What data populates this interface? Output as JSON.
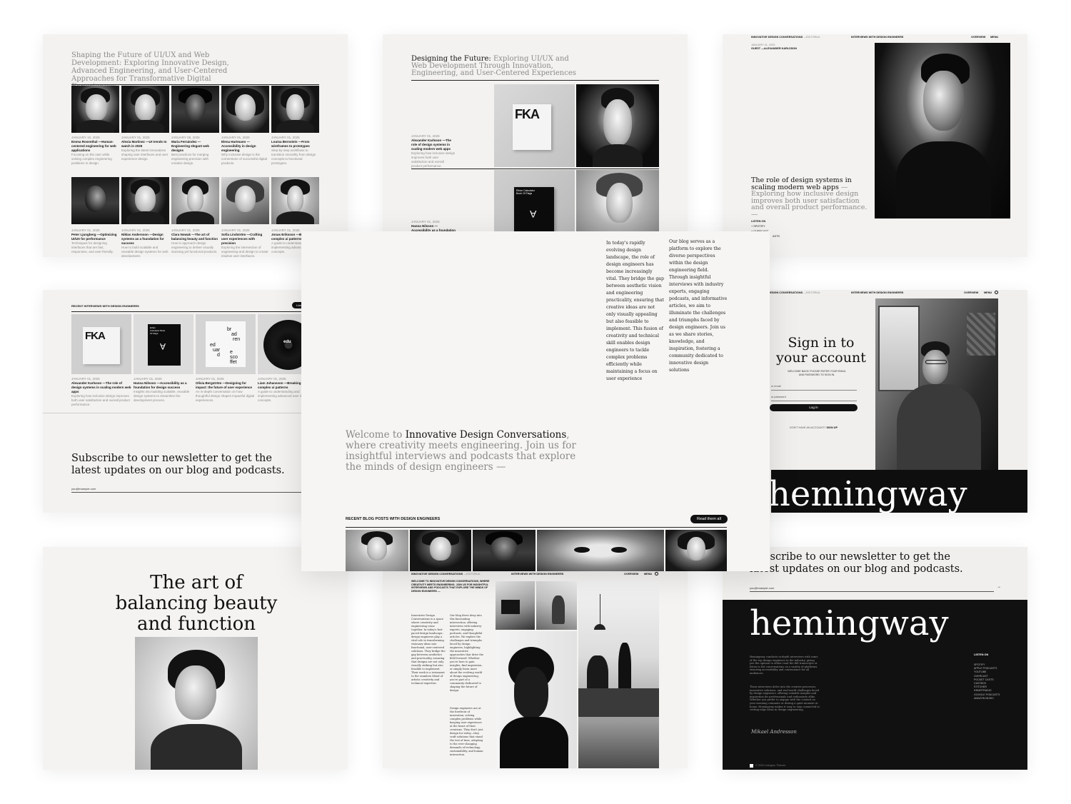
{
  "p1": {
    "headline": "Shaping the Future of UI/UX and Web Development: Exploring Innovative Design, Advanced Engineering, and User-Centered Approaches for Transformative Digital Experiences.",
    "row1": [
      {
        "date": "JANUARY 10, 2025",
        "title": "Emma Rosenthal —Human-centered engineering for web applications",
        "desc": "Focusing on the user while solving complex engineering problems in design."
      },
      {
        "date": "JANUARY 01, 2025",
        "title": "Alexia Martinez —UI trends to watch in 2025",
        "desc": "Exploring the latest innovations shaping user interfaces and user experience design."
      },
      {
        "date": "JANUARY 05, 2025",
        "title": "Maria Fernández —Engineering elegant web designs",
        "desc": "Best practices for merging engineering precision with creative design."
      },
      {
        "date": "JANUARY 01, 2025",
        "title": "Elena Hartmann —Accessibility in design engineering",
        "desc": "Why inclusive design is the cornerstone of successful digital products."
      },
      {
        "date": "JANUARY 01, 2025",
        "title": "Louisa Bernstein —From wireframes to prototypes",
        "desc": "Step-by-step workflows to transition smoothly from design concepts to functional prototypes."
      }
    ],
    "row2": [
      {
        "date": "JANUARY 01, 2025",
        "title": "Peter Ljungberg —Optimizing UI/UX for performance",
        "desc": "Techniques for designing interfaces that are fast, responsive, and user-friendly."
      },
      {
        "date": "JANUARY 01, 2025",
        "title": "Niklas Andersson —Design systems as a foundation for success",
        "desc": "How to build scalable and reusable design systems for web development."
      },
      {
        "date": "JANUARY 01, 2025",
        "title": "Clara Nowak —The art of balancing beauty and function",
        "desc": "How to approach design engineering to deliver visually stunning yet functional products."
      },
      {
        "date": "JANUARY 01, 2025",
        "title": "Sofia Lindström —Crafting user experiences with precision",
        "desc": "Exploring the intersection of engineering and design to create intuitive user interfaces."
      },
      {
        "date": "JANUARY 01, 2025",
        "title": "Jonas Eriksson —Bre complex ui patterns",
        "desc": "A guide to understand implementing advanc interface concepts."
      }
    ]
  },
  "p2": {
    "headline_dark": "Designing the Future:",
    "headline_gray": " Exploring UI/UX and Web Development Through Innovation, Engineering, and User-Centered Experiences",
    "post1": {
      "date": "JANUARY 01, 2025",
      "title": "Alexander Karlsson —The role of design systems in scaling modern web apps",
      "desc": "Exploring how inclusive design improves both user satisfaction and overall product performance."
    },
    "post2": {
      "date": "JANUARY 01, 2025",
      "title": "Hanna Nilsson —Accessibility as a foundation"
    },
    "fka_label": "FKA",
    "book_label": "Ethan Calculator Book Of Flags",
    "book_glyph": "A"
  },
  "p3": {
    "nav_brand": "INNOVATIVE DESIGN CONVERSATIONS",
    "nav_brand_sub": " —EDITORIAL",
    "nav_center": "INTERVIEWS WITH DESIGN ENGINEERS",
    "nav_overview": "OVERVIEW",
    "nav_menu": "MENU",
    "date": "JANUARY 01, 2025",
    "guest": "GUEST —ALEXANDER KARLSSON",
    "headline_dark": "The role of design systems in scaling modern web apps",
    "headline_gray": " — Exploring how inclusive design improves both user satisfaction and overall product performance. —",
    "listen_on": "LISTEN ON",
    "platforms": [
      "SPOTIFY",
      "OVERCAST",
      "ASTS"
    ]
  },
  "p4": {
    "heading": "RECENT INTERVIEWS WITH DESIGN ENGINEERS",
    "button": "Liste",
    "cards": [
      {
        "date": "JANUARY 01, 2025",
        "title": "Alexander Karlsson —The role of design systems in scaling modern web apps",
        "desc": "Exploring how inclusive design improves both user satisfaction and overall product performance."
      },
      {
        "date": "JANUARY 01, 2025",
        "title": "Hanna Nilsson —Accessibility as a foundation for design success",
        "desc": "Insights into building scalable, reusable design systems to streamline the development process."
      },
      {
        "date": "JANUARY 01, 2025",
        "title": "Olivia Bergström —Designing for impact: the future of user experience",
        "desc": "An in-depth conversation on how thoughtful design shapes impactful digital experiences."
      },
      {
        "date": "JANUARY 01, 2025",
        "title": "Liam Johansson —Breaking do complex ui patterns",
        "desc": "A guide to understanding and implementing advanced user interface concepts."
      }
    ],
    "fka_label": "FKA",
    "book_label": "Ethan Calculator Book Of Flags",
    "book_glyph": "A",
    "typo_words": [
      "br",
      "ad",
      "ren",
      "ed",
      "uar",
      "d",
      "e",
      "sco",
      "ffet"
    ],
    "vinyl_label": "edu",
    "subscribe": "Subscribe to our newsletter to get the latest updates on our blog and podcasts.",
    "email_placeholder": "you@example.com"
  },
  "p5": {
    "col1": "In today's rapidly evolving design landscape, the role of design engineers has become increasingly vital. They bridge the gap between aesthetic vision and engineering practicality, ensuring that creative ideas are not only visually appealing but also feasible to implement. This fusion of creativity and technical skill enables design engineers to tackle complex problems efficiently while maintaining a focus on user experience",
    "col2": "Our blog serves as a platform to explore the diverse perspectives within the design engineering field. Through insightful interviews with industry experts, engaging podcasts, and informative articles, we aim to illuminate the challenges and triumphs faced by design engineers. Join us as we share stories, knowledge, and inspiration, fostering a community dedicated to innovative design solutions",
    "welcome_gray": "Welcome to ",
    "welcome_dark": "Innovative Design Conversations",
    "welcome_rest": ", where creativity meets engineering. Join us for insightful interviews and podcasts that explore the minds of design engineers —",
    "recent_heading": "RECENT BLOG POSTS WITH DESIGN ENGINEERS",
    "read_button": "Read them all"
  },
  "p6": {
    "nav_brand": "INNOVATIVE DESIGN CONVERSATIONS",
    "nav_brand_sub": " —EDITORIAL",
    "nav_center": "INTERVIEWS WITH DESIGN ENGINEERS",
    "nav_overview": "OVERVIEW",
    "nav_menu": "MENU",
    "title_line1": "Sign in to",
    "title_line2": "your account",
    "welcome": "WELCOME BACK! PLEASE ENTER YOUR EMAIL AND PASSWORD TO SIGN IN.",
    "email_placeholder": "ur email",
    "password_placeholder": "ur password",
    "login_button": "Log in",
    "no_account": "DON'T HAVE AN ACCOUNT?",
    "signup": "SIGN UP",
    "brand_word": "hemingway"
  },
  "p7": {
    "title": "The art of balancing beauty and function"
  },
  "p8": {
    "nav_brand": "INNOVATIVE DESIGN CONVERSATIONS",
    "nav_brand_sub": " —EDITORIAL",
    "nav_center": "INTERVIEWS WITH DESIGN ENGINEERS",
    "nav_overview": "OVERVIEW",
    "nav_menu": "MENU",
    "intro": "WELCOME TO INNOVATIVE DESIGN CONVERSATIONS, WHERE CREATIVITY MEETS ENGINEERING. JOIN US FOR INSIGHTFUL INTERVIEWS AND PODCASTS THAT EXPLORE THE MINDS OF DESIGN ENGINEERS —",
    "col1": "Innovative Design Conversations is a space where creativity and engineering come together. In today's fast-paced design landscape, design engineers play a vital role in transforming visionary ideas into functional, user-centered solutions. They bridge the gap between aesthetics and practicality, ensuring that designs are not only visually striking but also feasible to implement. Their work is a testament to the seamless blend of artistic creativity and technical expertise.",
    "col2a": "Our blog dives deep into this fascinating intersection, offering interviews with industry experts, engaging podcasts, and thoughtful articles. We explore the challenges and triumphs faced by design engineers, highlighting the innovative approaches that drive the field forward. Whether you're here to gain insights, find inspiration, or simply learn more about the evolving world of design engineering, you're part of a community dedicated to shaping the future of design.",
    "col2b": "Design engineers are at the forefront of innovation, solving complex problems while keeping user experience at the heart of their creations. They don't just design for today—they craft solutions that stand the test of time, adapting to the ever-changing demands of technology, sustainability, and human interaction."
  },
  "p9": {
    "subscribe": "Subscribe to our newsletter to get the latest updates on our blog and podcasts.",
    "email_placeholder": "you@example.com",
    "arrow": "→",
    "brand_word": "hemingway",
    "para1": "Hemingway conducts in-depth interviews with some of the top design engineers in the industry, giving you the opinion to either read the full transcripts or listen to the conversations on a variety of platforms, ensuring accessibility and convenience for all audiences.",
    "para2": "These interviews delve into the creative processes, innovative solutions, and real-world challenges faced by design engineers, offering valuable insights and inspiration for professionals and enthusiasts alike. Whether you prefer to engage with the content on your morning commute or during a quiet moment at home, Hemingway makes it easy to stay connected to cutting-edge ideas in design engineering.",
    "signature": "Mikael Andresson",
    "listen_on": "LISTEN ON",
    "platforms": [
      "SPOTIFY",
      "APPLE PODCASTS",
      "YOUTUBE",
      "OVERCAST",
      "POCKET CASTS",
      "CASTBOX",
      "STITCHER",
      "IHEARTRADIO",
      "GOOGLE PODCASTS",
      "AMAZON MUSIC"
    ],
    "copyright": "© 2025 Lexington Themes"
  }
}
